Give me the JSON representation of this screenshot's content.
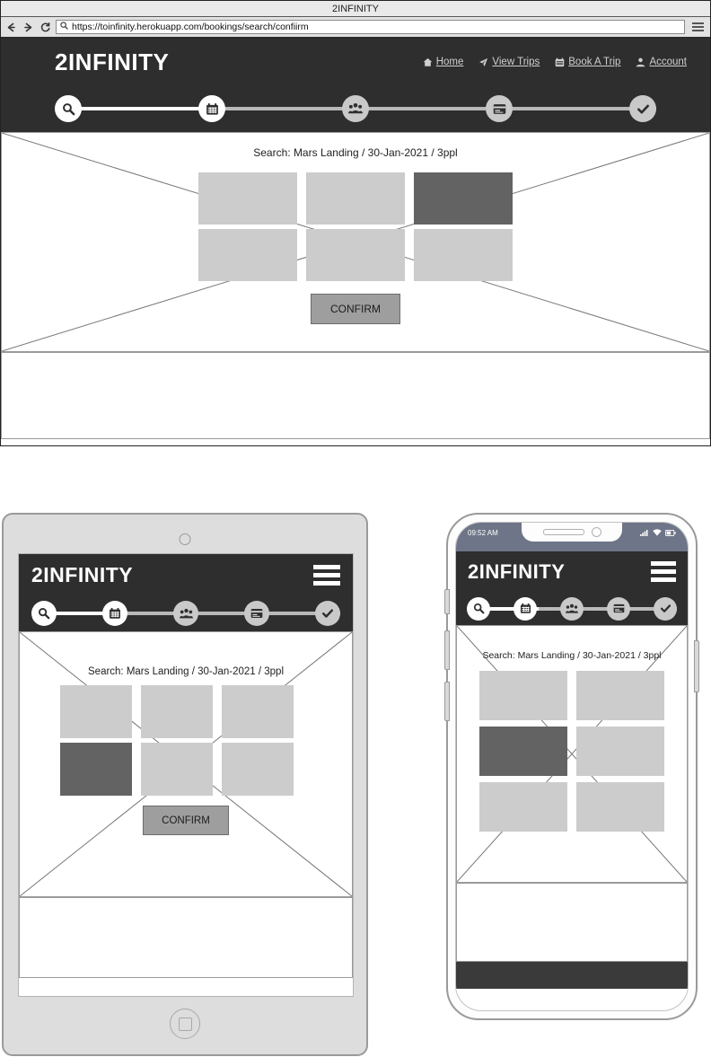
{
  "browser": {
    "title": "2INFINITY",
    "url": "https://toinfinity.herokuapp.com/bookings/search/confiirm",
    "back_icon": "←",
    "forward_icon": "→",
    "reload_icon": "↻",
    "search_glyph": "⌕"
  },
  "site": {
    "brand": "2INFINITY",
    "nav": [
      {
        "label": "Home",
        "icon": "home-icon"
      },
      {
        "label": "View Trips",
        "icon": "paper-plane-icon"
      },
      {
        "label": "Book A Trip",
        "icon": "calendar-icon"
      },
      {
        "label": "Account",
        "icon": "person-icon"
      }
    ]
  },
  "stepper": {
    "steps": [
      {
        "name": "search",
        "icon": "magnifier-icon",
        "state": "active"
      },
      {
        "name": "date",
        "icon": "calendar-icon",
        "state": "active"
      },
      {
        "name": "passengers",
        "icon": "people-icon",
        "state": "inactive"
      },
      {
        "name": "payment",
        "icon": "credit-card-icon",
        "state": "inactive"
      },
      {
        "name": "confirm",
        "icon": "check-icon",
        "state": "inactive"
      }
    ]
  },
  "page": {
    "search_summary": "Search: Mars Landing / 30-Jan-2021 / 3ppl",
    "confirm_label": "CONFIRM",
    "desktop_cards": [
      {
        "selected": false
      },
      {
        "selected": false
      },
      {
        "selected": true
      },
      {
        "selected": false
      },
      {
        "selected": false
      },
      {
        "selected": false
      }
    ],
    "tablet_cards": [
      {
        "selected": false
      },
      {
        "selected": false
      },
      {
        "selected": false
      },
      {
        "selected": true
      },
      {
        "selected": false
      },
      {
        "selected": false
      }
    ],
    "phone_cards": [
      {
        "selected": false
      },
      {
        "selected": false
      },
      {
        "selected": true
      },
      {
        "selected": false
      },
      {
        "selected": false
      },
      {
        "selected": false
      }
    ]
  },
  "mobile": {
    "menu_icon": "hamburger-icon"
  },
  "phone": {
    "status_time": "09:52 AM",
    "signal_icon": "signal-bars-icon",
    "wifi_icon": "wifi-icon",
    "battery_icon": "battery-icon"
  },
  "colors": {
    "header_bg": "#2e2e2e",
    "card": "#cccccc",
    "card_selected": "#636363",
    "confirm_bg": "#9e9e9e",
    "status_bar": "#6f7588"
  }
}
